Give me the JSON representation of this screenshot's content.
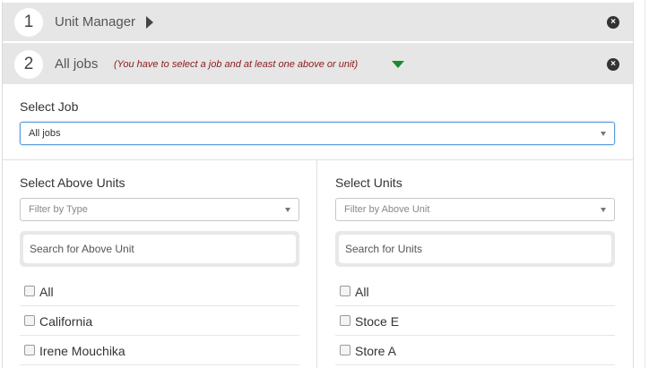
{
  "steps": [
    {
      "number": "1",
      "title": "Unit Manager",
      "close": "×"
    },
    {
      "number": "2",
      "title": "All jobs",
      "hint": "(You have to select a job and at least one above or unit)",
      "close": "×"
    }
  ],
  "job": {
    "label": "Select Job",
    "value": "All jobs"
  },
  "above_units": {
    "label": "Select Above Units",
    "filter_placeholder": "Filter by Type",
    "search_placeholder": "Search for Above Unit",
    "items": [
      "All",
      "California",
      "Irene Mouchika"
    ]
  },
  "units": {
    "label": "Select Units",
    "filter_placeholder": "Filter by Above Unit",
    "search_placeholder": "Search for Units",
    "items": [
      "All",
      "Stoce E",
      "Store A"
    ]
  },
  "colors": {
    "hint": "#8b1a1a",
    "expand_arrow": "#1a8a2a",
    "header_bg": "#e6e6e6"
  }
}
